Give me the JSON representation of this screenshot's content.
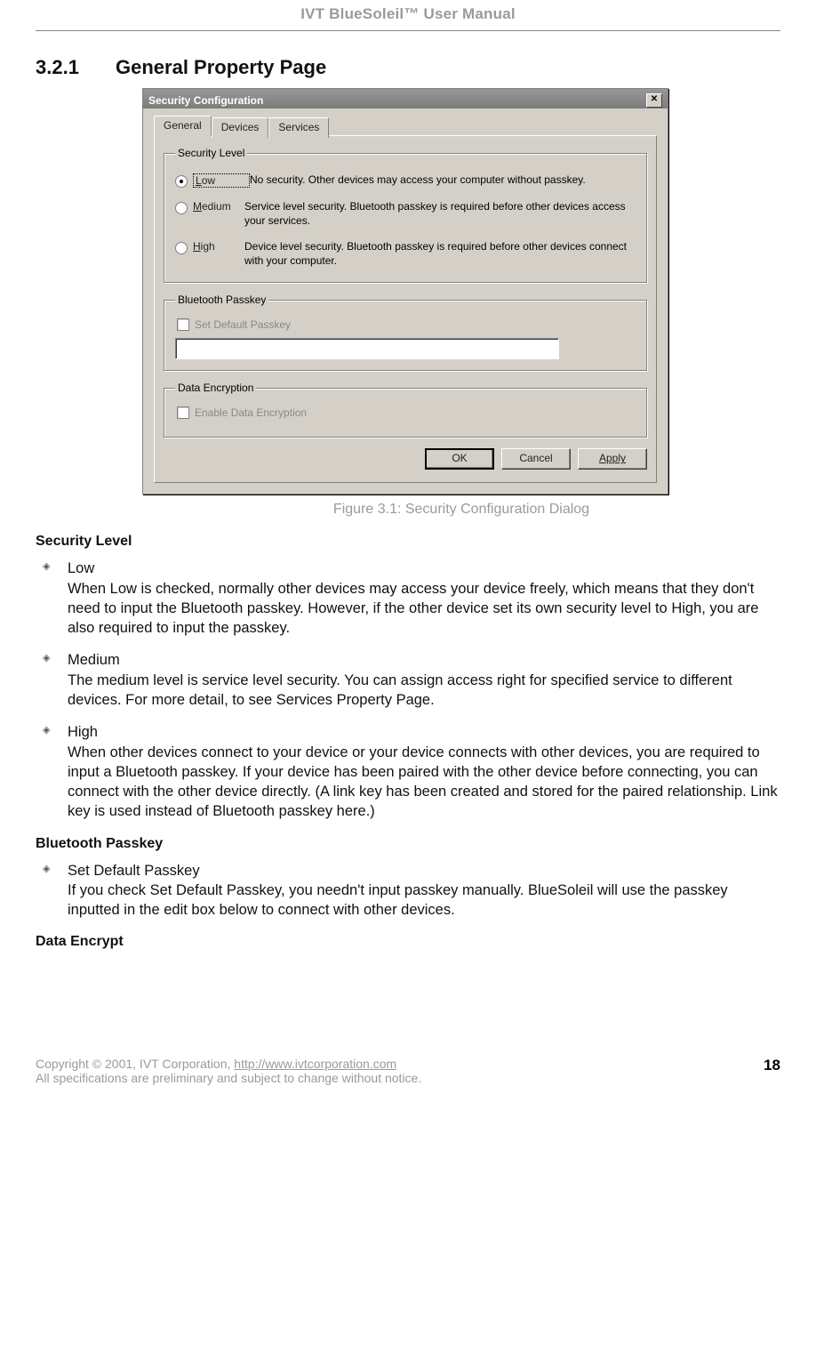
{
  "header": {
    "title": "IVT BlueSoleil™ User Manual"
  },
  "section": {
    "num": "3.2.1",
    "title": "General Property Page"
  },
  "dialog": {
    "title": "Security Configuration",
    "tabs": {
      "general": "General",
      "devices": "Devices",
      "services": "Services"
    },
    "group_security": "Security Level",
    "radio_low": "Low",
    "radio_low_desc": "No security. Other devices may access your computer without passkey.",
    "radio_medium": "Medium",
    "radio_medium_desc": "Service level security. Bluetooth passkey is required before other devices access your services.",
    "radio_high": "High",
    "radio_high_desc": "Device level security. Bluetooth passkey is required before other devices connect with your computer.",
    "group_passkey": "Bluetooth Passkey",
    "chk_passkey": "Set Default Passkey",
    "group_encrypt": "Data Encryption",
    "chk_encrypt": "Enable Data Encryption",
    "btn_ok": "OK",
    "btn_cancel": "Cancel",
    "btn_apply": "Apply"
  },
  "caption": "Figure 3.1: Security Configuration Dialog",
  "body": {
    "h_security": "Security Level",
    "low_t": "Low",
    "low_b": "When Low is checked, normally other devices may access your device freely, which means that they don't need to input the Bluetooth passkey. However, if the other device set its own security level to High, you are also required to input the passkey.",
    "med_t": "Medium",
    "med_b": "The medium level is service level security. You can assign access right for specified service to different devices. For more detail, to see Services Property Page.",
    "high_t": "High",
    "high_b": "When other devices connect to your device or your device connects with other devices, you are required to input a Bluetooth passkey. If your device has been paired with the other device before connecting, you can connect with the other device directly. (A link key has been created and stored for the paired relationship. Link key is used instead of Bluetooth passkey here.)",
    "h_passkey": "Bluetooth Passkey",
    "pk_t": "Set Default Passkey",
    "pk_b": "If you check Set Default Passkey, you needn't input passkey manually. BlueSoleil will use the passkey inputted in the edit box below to connect with other devices.",
    "h_encrypt": "Data Encrypt"
  },
  "footer": {
    "line1a": "Copyright © 2001, IVT Corporation, ",
    "url": "http://www.ivtcorporation.com",
    "line2": "All specifications are preliminary and subject to change without notice.",
    "page": "18"
  }
}
